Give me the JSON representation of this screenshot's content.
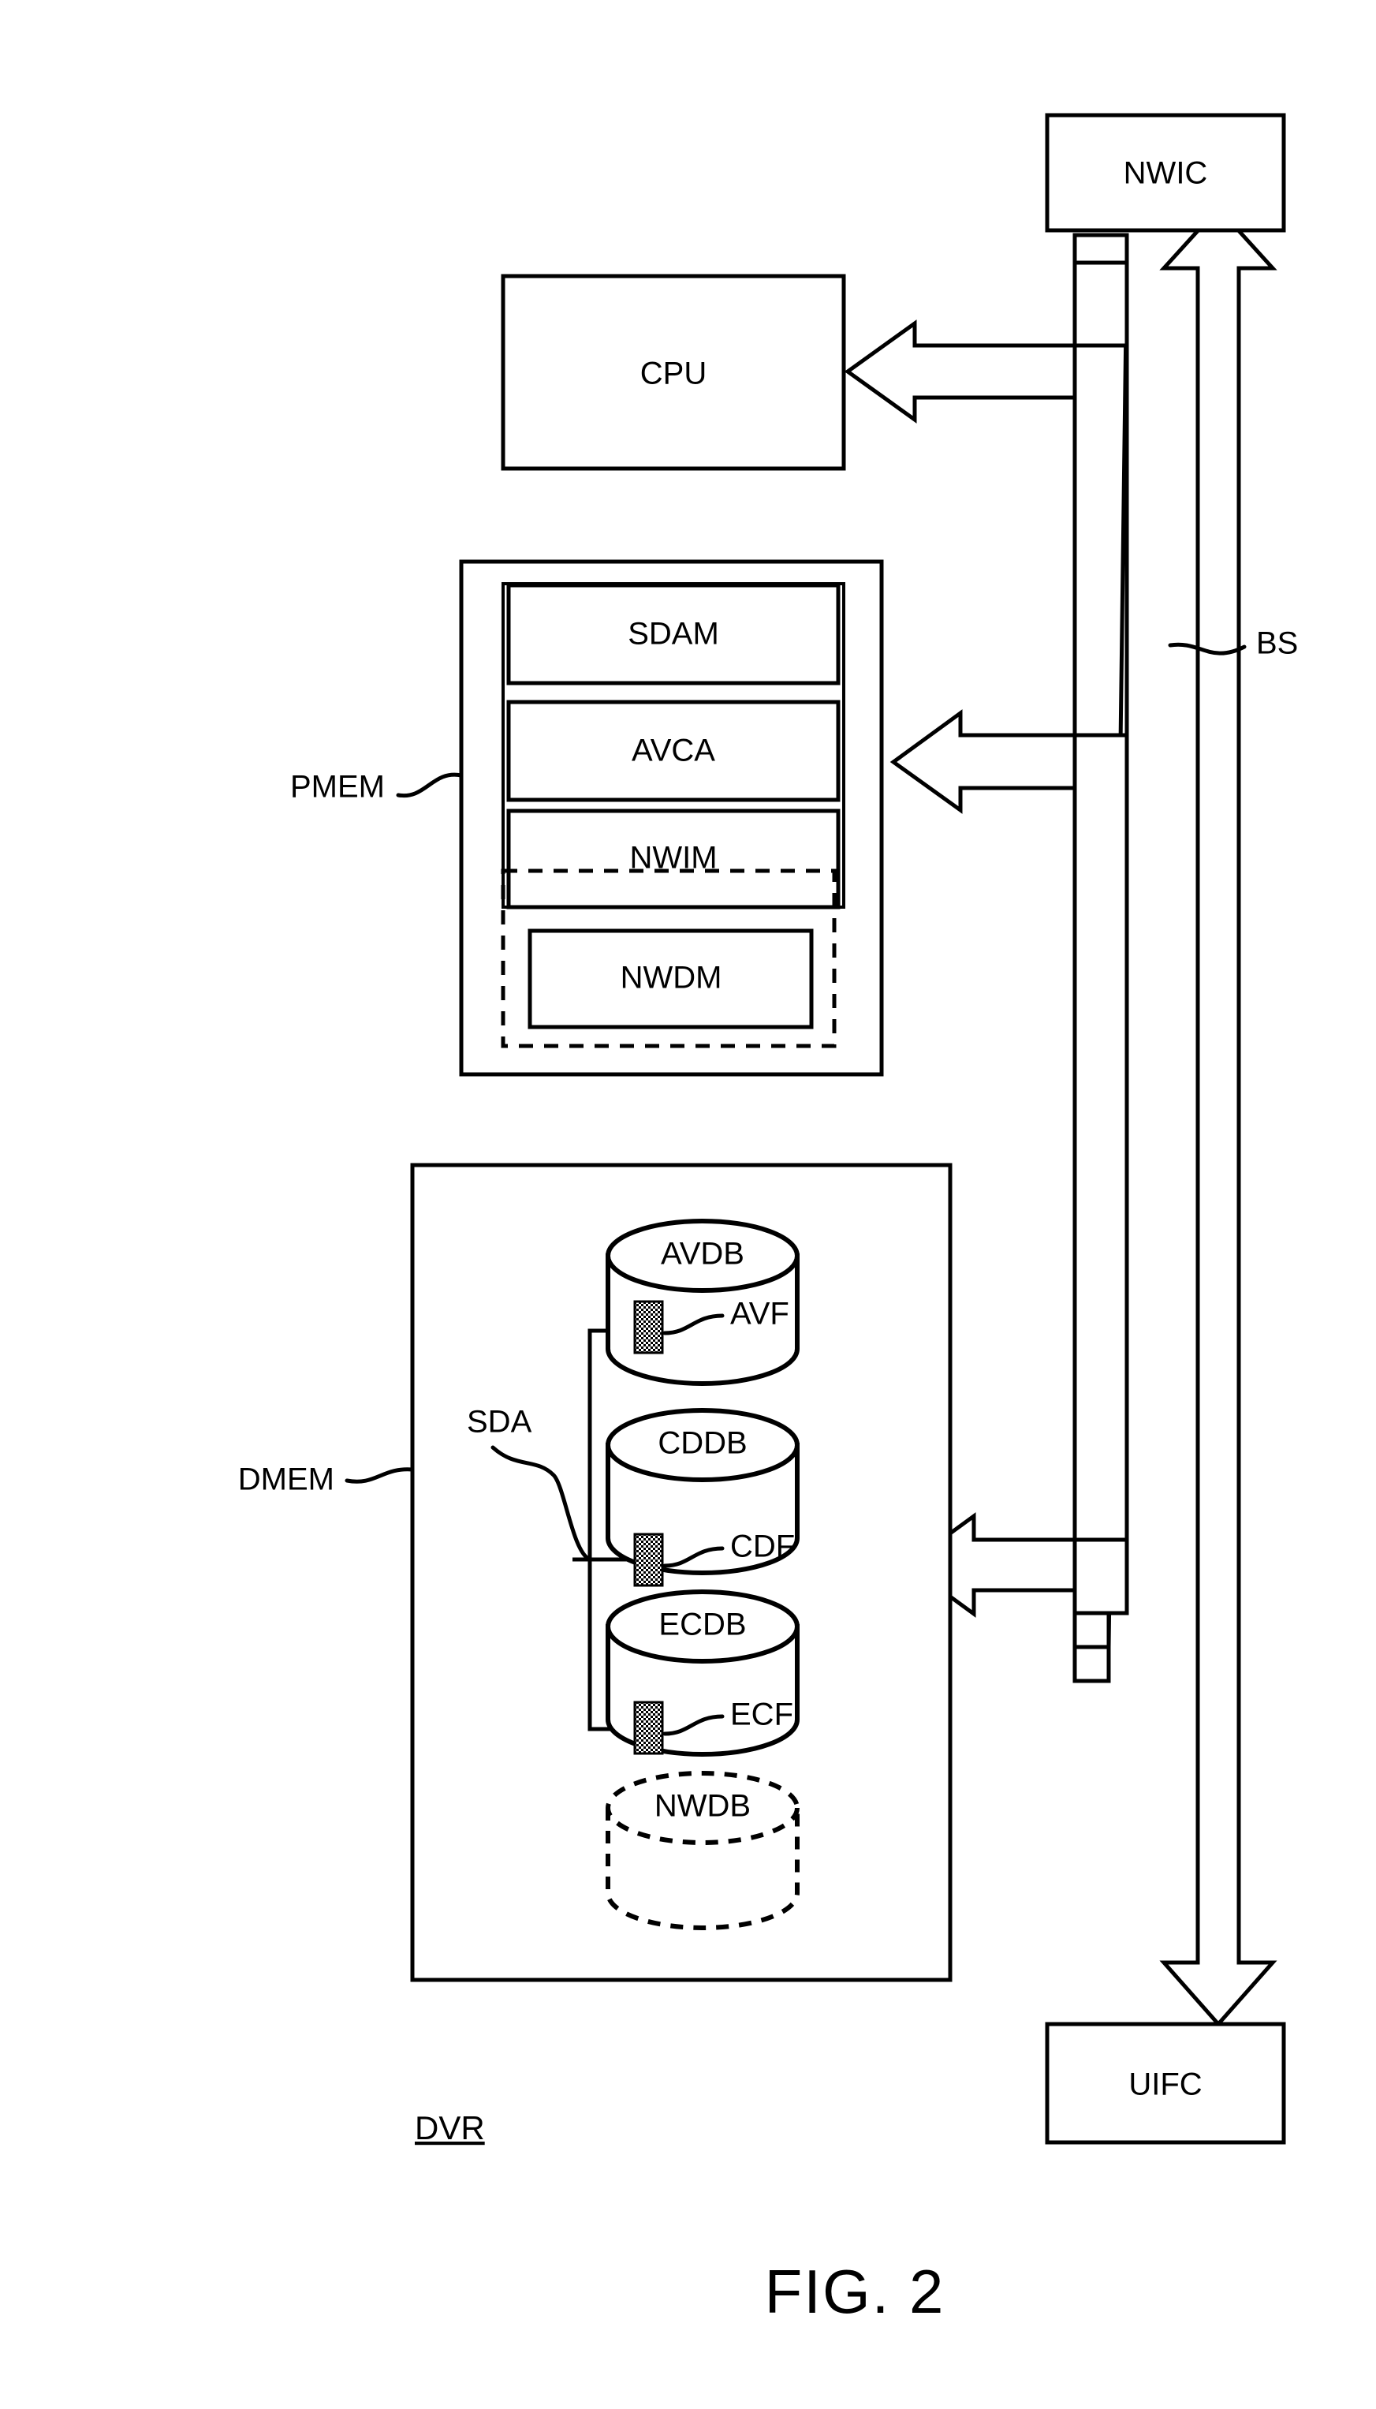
{
  "figure": {
    "caption": "FIG. 2",
    "system_label": "DVR"
  },
  "blocks": {
    "nwic": "NWIC",
    "cpu": "CPU",
    "uifc": "UIFC",
    "pmem_label": "PMEM",
    "dmem_label": "DMEM",
    "bus_label": "BS",
    "sda_label": "SDA"
  },
  "pmem_modules": [
    {
      "label": "SDAM",
      "style": "solid"
    },
    {
      "label": "AVCA",
      "style": "solid"
    },
    {
      "label": "NWIM",
      "style": "solid"
    },
    {
      "label": "NWDM",
      "style": "solid-in-dashed"
    }
  ],
  "dmem_databases": [
    {
      "label": "AVDB",
      "file_label": "AVF",
      "style": "solid"
    },
    {
      "label": "CDDB",
      "file_label": "CDF",
      "style": "solid"
    },
    {
      "label": "ECDB",
      "file_label": "ECF",
      "style": "solid"
    },
    {
      "label": "NWDB",
      "file_label": "",
      "style": "dashed"
    }
  ],
  "colors": {
    "stroke": "#000000",
    "background": "#ffffff",
    "hatch_fill": "#9a9a9a"
  }
}
